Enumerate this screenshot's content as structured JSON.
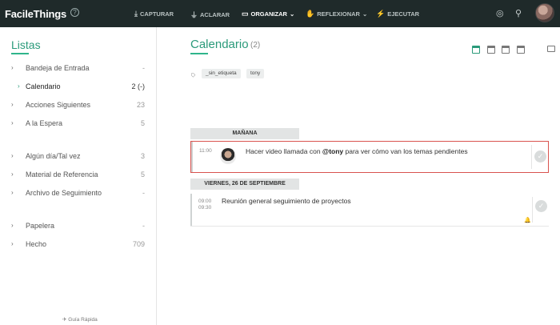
{
  "app": {
    "logo": "FacileThings",
    "help": "?"
  },
  "nav": [
    {
      "label": "CAPTURAR",
      "icon": "download-icon"
    },
    {
      "label": "ACLARAR",
      "icon": "funnel-icon"
    },
    {
      "label": "ORGANIZAR",
      "icon": "folder-icon",
      "active": true
    },
    {
      "label": "REFLEXIONAR",
      "icon": "hand-icon"
    },
    {
      "label": "EJECUTAR",
      "icon": "lightning-icon"
    }
  ],
  "sidebar": {
    "title": "Listas",
    "items": [
      {
        "label": "Bandeja de Entrada",
        "count": "-"
      },
      {
        "label": "Calendario",
        "count": "2 (-)"
      },
      {
        "label": "Acciones Siguientes",
        "count": "23"
      },
      {
        "label": "A la Espera",
        "count": "5"
      },
      {
        "label": "Algún día/Tal vez",
        "count": "3"
      },
      {
        "label": "Material de Referencia",
        "count": "5"
      },
      {
        "label": "Archivo de Seguimiento",
        "count": "-"
      },
      {
        "label": "Papelera",
        "count": "-"
      },
      {
        "label": "Hecho",
        "count": "709"
      }
    ],
    "guide": "Guía Rápida"
  },
  "main": {
    "title": "Calendario",
    "count": "(2)",
    "tags": [
      "_sin_etiqueta",
      "tony"
    ],
    "groups": [
      {
        "header": "MAÑANA",
        "task": {
          "time": "11:00",
          "text_before": "Hacer video llamada con ",
          "mention": "@tony",
          "text_after": " para ver cómo van los temas pendientes"
        }
      },
      {
        "header": "VIERNES, 26 DE SEPTIEMBRE",
        "task": {
          "time_start": "09:00",
          "time_end": "09:30",
          "text": "Reunión general seguimiento de proyectos"
        }
      }
    ]
  },
  "colors": {
    "accent": "#2a9a7a",
    "topbar": "#1f2a2a",
    "highlight": "#d9534f"
  }
}
